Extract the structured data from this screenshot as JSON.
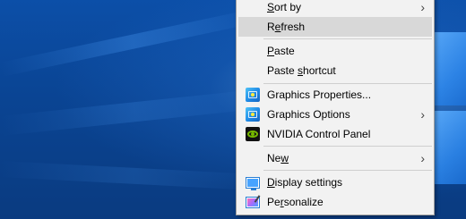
{
  "context_menu": {
    "items": [
      {
        "label_pre": "",
        "label_u": "S",
        "label_post": "ort by",
        "submenu": true,
        "icon": ""
      },
      {
        "label_pre": "R",
        "label_u": "e",
        "label_post": "fresh",
        "submenu": false,
        "icon": "",
        "highlighted": true
      },
      {
        "label_pre": "",
        "label_u": "P",
        "label_post": "aste",
        "submenu": false,
        "icon": ""
      },
      {
        "label_pre": "Paste ",
        "label_u": "s",
        "label_post": "hortcut",
        "submenu": false,
        "icon": ""
      },
      {
        "label_pre": "",
        "label_u": "",
        "label_post": "Graphics Properties...",
        "submenu": false,
        "icon": "graphics-icon"
      },
      {
        "label_pre": "",
        "label_u": "",
        "label_post": "Graphics Options",
        "submenu": true,
        "icon": "graphics-icon"
      },
      {
        "label_pre": "",
        "label_u": "",
        "label_post": "NVIDIA Control Panel",
        "submenu": false,
        "icon": "nvidia-icon"
      },
      {
        "label_pre": "Ne",
        "label_u": "w",
        "label_post": "",
        "submenu": true,
        "icon": ""
      },
      {
        "label_pre": "",
        "label_u": "D",
        "label_post": "isplay settings",
        "submenu": false,
        "icon": "display-icon"
      },
      {
        "label_pre": "Pe",
        "label_u": "r",
        "label_post": "sonalize",
        "submenu": false,
        "icon": "personalize-icon"
      }
    ],
    "submenu_arrow": "›"
  },
  "colors": {
    "menu_bg": "#f2f2f2",
    "highlight": "#d8d8d8",
    "desktop_blue": "#0a4493"
  }
}
